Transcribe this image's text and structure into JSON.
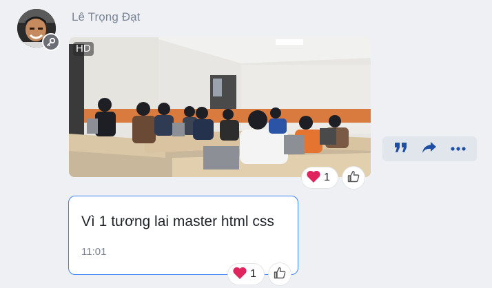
{
  "sender": {
    "name": "Lê Trọng Đạt"
  },
  "photo_message": {
    "quality_badge": "HD",
    "reaction": {
      "emoji_icon": "heart-icon",
      "count": "1"
    }
  },
  "text_message": {
    "text": "Vì 1 tương lai master html css",
    "time": "11:01",
    "reaction": {
      "emoji_icon": "heart-icon",
      "count": "1"
    }
  },
  "actions": [
    "quote-icon",
    "share-icon",
    "more-icon"
  ],
  "colors": {
    "background": "#eef0f4",
    "bubble_border": "#3b82f6",
    "action_icon": "#1e4fa3",
    "heart": "#e0245e"
  }
}
